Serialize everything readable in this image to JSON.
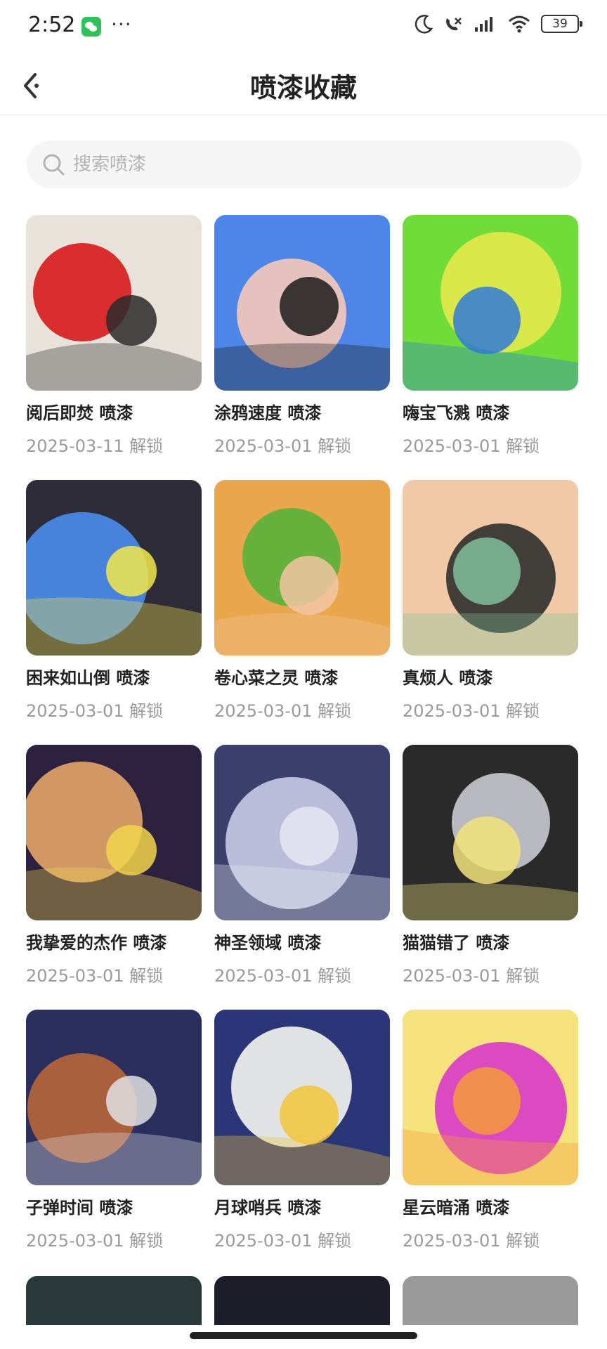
{
  "status_bar": {
    "time": "2:52",
    "more": "···",
    "battery": "39",
    "icons": [
      "wechat-icon",
      "moon-icon",
      "call-muted-icon",
      "signal-icon",
      "wifi-icon",
      "battery-icon"
    ]
  },
  "header": {
    "title": "喷漆收藏",
    "back_icon": "back-arrow-icon"
  },
  "search": {
    "placeholder": "搜索喷漆",
    "value": ""
  },
  "sprays": [
    {
      "name": "阅后即焚 喷漆",
      "date": "2025-03-11 解锁",
      "colors": [
        "#e8e2da",
        "#d81b1b",
        "#2a2a2a"
      ]
    },
    {
      "name": "涂鸦速度 喷漆",
      "date": "2025-03-01 解锁",
      "colors": [
        "#4d86e8",
        "#f6c9b8",
        "#1c1c1c"
      ]
    },
    {
      "name": "嗨宝飞溅 喷漆",
      "date": "2025-03-01 解锁",
      "colors": [
        "#6fdc3a",
        "#e6e84a",
        "#2f7ad8"
      ]
    },
    {
      "name": "困来如山倒 喷漆",
      "date": "2025-03-01 解锁",
      "colors": [
        "#2f2c3a",
        "#4a8cf0",
        "#f3e84a"
      ]
    },
    {
      "name": "卷心菜之灵 喷漆",
      "date": "2025-03-01 解锁",
      "colors": [
        "#e9a64a",
        "#56b23a",
        "#f2c7a4"
      ]
    },
    {
      "name": "真烦人 喷漆",
      "date": "2025-03-01 解锁",
      "colors": [
        "#f1c9a6",
        "#2f2f2f",
        "#7fbf9a"
      ]
    },
    {
      "name": "我挚爱的杰作 喷漆",
      "date": "2025-03-01 解锁",
      "colors": [
        "#2d2140",
        "#e3a56a",
        "#f2d34a"
      ]
    },
    {
      "name": "神圣领域 喷漆",
      "date": "2025-03-01 解锁",
      "colors": [
        "#3a3f6b",
        "#c9cbe6",
        "#e6e6f2"
      ]
    },
    {
      "name": "猫猫错了 喷漆",
      "date": "2025-03-01 解锁",
      "colors": [
        "#2a2a2a",
        "#c8c8d0",
        "#f2e27a"
      ]
    },
    {
      "name": "子弹时间 喷漆",
      "date": "2025-03-01 解锁",
      "colors": [
        "#2a2f5e",
        "#b8653a",
        "#e0e0e0"
      ]
    },
    {
      "name": "月球哨兵 喷漆",
      "date": "2025-03-01 解锁",
      "colors": [
        "#2b3678",
        "#f5f5f0",
        "#f2c43a"
      ]
    },
    {
      "name": "星云暗涌 喷漆",
      "date": "2025-03-01 解锁",
      "colors": [
        "#f5e27a",
        "#d83ac8",
        "#f59a3a"
      ]
    }
  ],
  "partial_row_colors": [
    "#2a3a3a",
    "#1e1e2a",
    "#9a9a9a"
  ]
}
